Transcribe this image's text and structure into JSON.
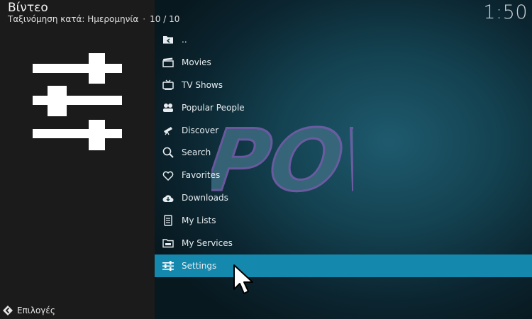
{
  "header": {
    "title": "Βίντεο",
    "sort_label": "Ταξινόμηση κατά: Ημερομηνία",
    "separator": "·",
    "count": "10 / 10"
  },
  "clock": "1:50",
  "watermark": "POV",
  "menu": {
    "items": [
      {
        "label": "..",
        "icon": "folder-back-icon"
      },
      {
        "label": "Movies",
        "icon": "clapperboard-icon"
      },
      {
        "label": "TV Shows",
        "icon": "tv-icon"
      },
      {
        "label": "Popular People",
        "icon": "people-icon"
      },
      {
        "label": "Discover",
        "icon": "telescope-icon"
      },
      {
        "label": "Search",
        "icon": "search-icon"
      },
      {
        "label": "Favorites",
        "icon": "heart-icon"
      },
      {
        "label": "Downloads",
        "icon": "cloud-download-icon"
      },
      {
        "label": "My Lists",
        "icon": "list-icon"
      },
      {
        "label": "My Services",
        "icon": "folder-services-icon"
      },
      {
        "label": "Settings",
        "icon": "sliders-icon"
      }
    ],
    "selected_index": 10
  },
  "footer": {
    "options_label": "Επιλογές"
  },
  "colors": {
    "selection": "#1488ad",
    "left_panel": "#1b1b1b"
  }
}
